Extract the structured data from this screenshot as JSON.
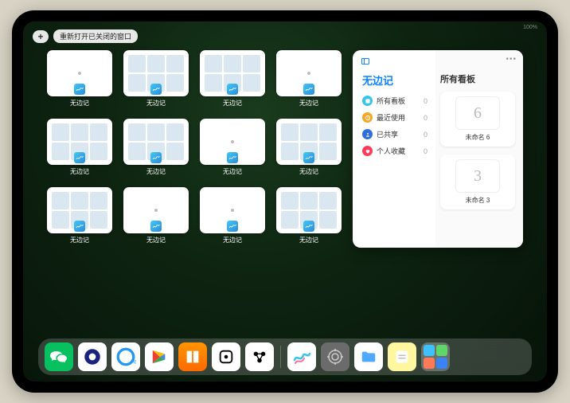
{
  "status": {
    "right": "100%"
  },
  "topbar": {
    "plus": "+",
    "reopen": "重新打开已关闭的窗口"
  },
  "tiles": [
    {
      "label": "无边记",
      "variant": "blank"
    },
    {
      "label": "无边记",
      "variant": "grid"
    },
    {
      "label": "无边记",
      "variant": "grid"
    },
    {
      "label": "无边记",
      "variant": "blank"
    },
    {
      "label": "无边记",
      "variant": "grid"
    },
    {
      "label": "无边记",
      "variant": "grid"
    },
    {
      "label": "无边记",
      "variant": "blank"
    },
    {
      "label": "无边记",
      "variant": "grid"
    },
    {
      "label": "无边记",
      "variant": "grid"
    },
    {
      "label": "无边记",
      "variant": "blank"
    },
    {
      "label": "无边记",
      "variant": "blank"
    },
    {
      "label": "无边记",
      "variant": "grid"
    }
  ],
  "stage": {
    "title": "无边记",
    "right_title": "所有看板",
    "categories": [
      {
        "label": "所有看板",
        "count": "0",
        "color": "#34c4ec"
      },
      {
        "label": "最近使用",
        "count": "0",
        "color": "#f5a623"
      },
      {
        "label": "已共享",
        "count": "0",
        "color": "#2f6edb"
      },
      {
        "label": "个人收藏",
        "count": "0",
        "color": "#ff3b5b"
      }
    ],
    "boards": [
      {
        "glyph": "6",
        "name": "未命名 6",
        "sub": ""
      },
      {
        "glyph": "3",
        "name": "未命名 3",
        "sub": ""
      }
    ]
  },
  "dock": {
    "items": [
      {
        "name": "wechat-icon",
        "bg": "#07c160"
      },
      {
        "name": "quark-icon",
        "bg": "#ffffff"
      },
      {
        "name": "qqbrowser-icon",
        "bg": "#ffffff"
      },
      {
        "name": "play-icon",
        "bg": "#ffffff"
      },
      {
        "name": "books-icon",
        "bg": "linear-gradient(#ff9500,#ff6a00)"
      },
      {
        "name": "dice-icon",
        "bg": "#ffffff"
      },
      {
        "name": "molecule-icon",
        "bg": "#ffffff"
      }
    ],
    "recent": [
      {
        "name": "freeform-icon",
        "bg": "#ffffff"
      },
      {
        "name": "settings-icon",
        "bg": "#6b6b6b"
      },
      {
        "name": "files-icon",
        "bg": "#ffffff"
      },
      {
        "name": "notes-icon",
        "bg": "#fff7a0"
      }
    ],
    "group": {
      "name": "app-library-icon",
      "cells": [
        "#3ec1ff",
        "#5fd66a",
        "#ff7a59",
        "#3b82f6"
      ]
    }
  }
}
